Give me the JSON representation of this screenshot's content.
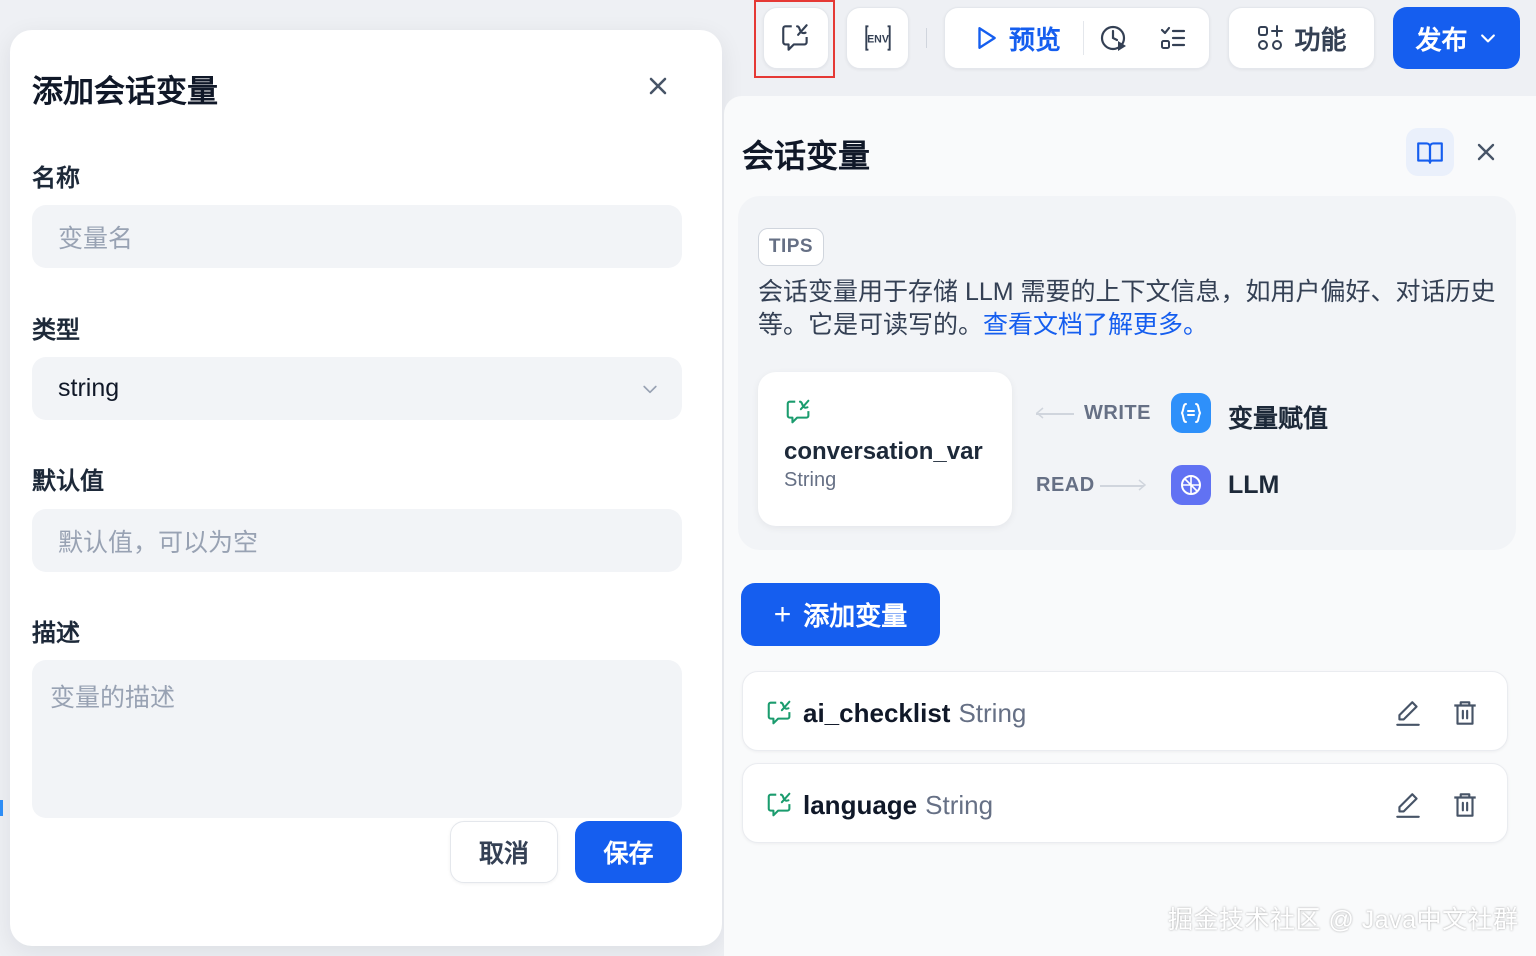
{
  "modal": {
    "title": "添加会话变量",
    "name_label": "名称",
    "name_placeholder": "变量名",
    "type_label": "类型",
    "type_value": "string",
    "default_label": "默认值",
    "default_placeholder": "默认值，可以为空",
    "description_label": "描述",
    "description_placeholder": "变量的描述",
    "cancel_label": "取消",
    "save_label": "保存"
  },
  "toolbar": {
    "env_label": "ENV",
    "preview_label": "预览",
    "feature_label": "功能",
    "publish_label": "发布"
  },
  "panel": {
    "title": "会话变量",
    "tips_badge": "TIPS",
    "tips_text": "会话变量用于存储 LLM 需要的上下文信息，如用户偏好、对话历史等。它是可读写的。",
    "tips_link": "查看文档了解更多。",
    "example": {
      "name": "conversation_var",
      "type": "String",
      "write_label": "WRITE",
      "read_label": "READ",
      "assign_node": "变量赋值",
      "llm_node": "LLM"
    },
    "add_button": "添加变量",
    "plus": "+",
    "variables": [
      {
        "name": "ai_checklist",
        "type": "String"
      },
      {
        "name": "language",
        "type": "String"
      }
    ]
  },
  "watermark": "掘金技术社区 @ Java中文社群",
  "colors": {
    "accent": "#155eef",
    "highlight": "#e53935",
    "assign_node": "#2e90fa",
    "llm_node": "#6172f3"
  }
}
